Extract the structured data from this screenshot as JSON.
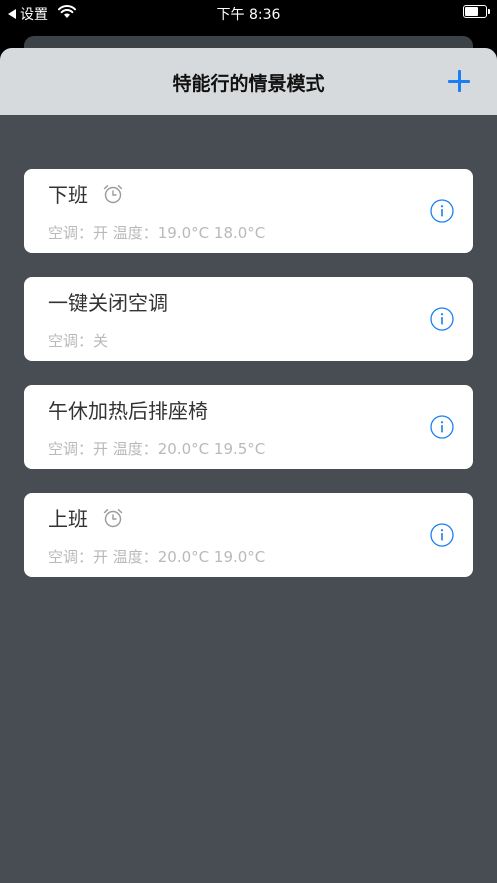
{
  "status_bar": {
    "back_label": "设置",
    "time": "下午 8:36"
  },
  "nav": {
    "title": "特能行的情景模式",
    "add_icon": "plus-icon"
  },
  "colors": {
    "accent": "#1a7ff0",
    "background": "#474d52",
    "nav_background": "#d7dadc"
  },
  "scenes": [
    {
      "name": "下班",
      "has_alarm": true,
      "detail": "空调：开 温度：19.0°C 18.0°C"
    },
    {
      "name": "一键关闭空调",
      "has_alarm": false,
      "detail": "空调：关"
    },
    {
      "name": "午休加热后排座椅",
      "has_alarm": false,
      "detail": "空调：开 温度：20.0°C 19.5°C"
    },
    {
      "name": "上班",
      "has_alarm": true,
      "detail": "空调：开 温度：20.0°C 19.0°C"
    }
  ]
}
